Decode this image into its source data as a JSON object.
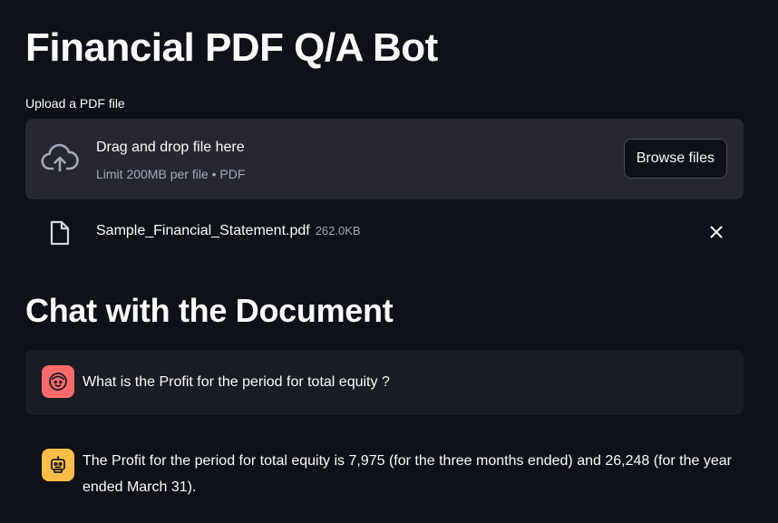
{
  "app": {
    "title": "Financial PDF Q/A Bot"
  },
  "uploader": {
    "label": "Upload a PDF file",
    "drop_text": "Drag and drop file here",
    "limit_text": "Limit 200MB per file • PDF",
    "browse_label": "Browse files",
    "icon": "cloud-upload-icon"
  },
  "uploaded_file": {
    "name": "Sample_Financial_Statement.pdf",
    "size": "262.0KB",
    "icon": "file-icon",
    "remove_icon": "close-icon"
  },
  "chat": {
    "heading": "Chat with the Document",
    "messages": [
      {
        "role": "user",
        "avatar_icon": "user-face-icon",
        "avatar_color": "#ff6b6b",
        "text": "What is the Profit for the period for total equity ?"
      },
      {
        "role": "assistant",
        "avatar_icon": "robot-icon",
        "avatar_color": "#ffbd45",
        "text": "The Profit for the period for total equity is 7,975 (for the three months ended) and 26,248 (for the year ended March 31)."
      }
    ]
  },
  "colors": {
    "background": "#0e1117",
    "panel": "#262730",
    "user_message_bg": "#1a1c24",
    "text": "#fafafa",
    "muted_text": "#a3a8b8"
  }
}
